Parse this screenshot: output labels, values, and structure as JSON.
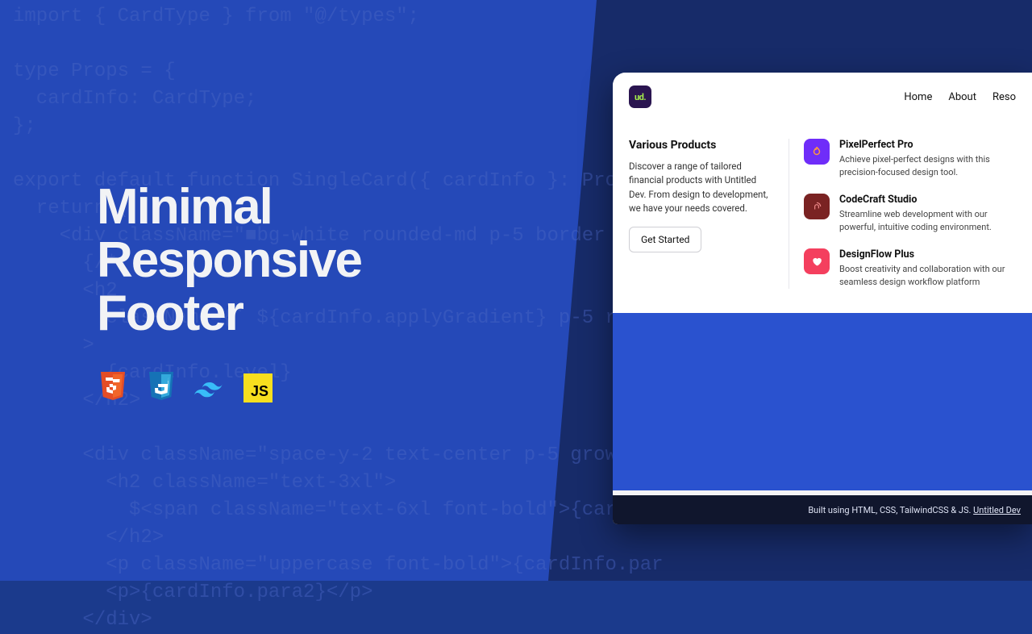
{
  "headline": {
    "l1": "Minimal",
    "l2": "Responsive",
    "l3": "Footer"
  },
  "code": "import { CardType } from \"@/types\";\n\ntype Props = {\n  cardInfo: CardType;\n};\n\nexport default function SingleCard({ cardInfo }: Props) {\n  return (\n    <div className=\"■bg-white rounded-md p-5 border ■border-\n      {/*\n      <h2\n        className={` ${cardInfo.applyGradient} p-5 rounded-md\n      >\n        {cardInfo.level}\n      </h2>\n\n      <div className=\"space-y-2 text-center p-5 grow\">\n        <h2 className=\"text-3xl\">\n          $<span className=\"text-6xl font-bold\">{cardInfo\n        </h2>\n        <p className=\"uppercase font-bold\">{cardInfo.par\n        <p>{cardInfo.para2}</p>\n      </div>",
  "tech": [
    "html5-icon",
    "css3-icon",
    "tailwind-icon",
    "js-icon"
  ],
  "mock": {
    "logo": "ud.",
    "nav": [
      "Home",
      "About",
      "Reso"
    ],
    "left": {
      "title": "Various Products",
      "text": "Discover a range of tailored financial products with Untitled Dev. From design to development, we have your needs covered.",
      "button": "Get Started"
    },
    "items": [
      {
        "icon": "flame-icon",
        "title": "PixelPerfect Pro",
        "text": "Achieve pixel-perfect designs with this precision-focused design tool."
      },
      {
        "icon": "fingerprint-icon",
        "title": "CodeCraft Studio",
        "text": "Streamline web development with our powerful, intuitive coding environment."
      },
      {
        "icon": "heart-icon",
        "title": "DesignFlow Plus",
        "text": "Boost creativity and collaboration with our seamless design workflow platform"
      }
    ],
    "footer_prefix": "Built using HTML, CSS, TailwindCSS & JS. ",
    "footer_link": "Untitled Dev"
  }
}
